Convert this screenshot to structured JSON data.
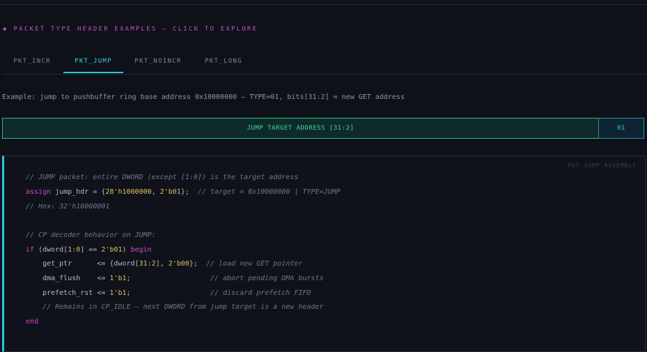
{
  "section_title": "PACKET TYPE HEADER EXAMPLES — CLICK TO EXPLORE",
  "tabs": [
    {
      "label": "PKT_INCR"
    },
    {
      "label": "PKT_JUMP"
    },
    {
      "label": "PKT_NOINCR"
    },
    {
      "label": "PKT_LONG"
    }
  ],
  "active_tab": "PKT_JUMP",
  "description": "Example: jump to pushbuffer ring base address 0x10000000 — TYPE=01, bits[31:2] = new GET address",
  "fields": [
    {
      "label": "JUMP TARGET ADDRESS [31:2]"
    },
    {
      "label": "01"
    }
  ],
  "code_caption": "PKT_JUMP ASSEMBLY",
  "code": {
    "l1": "// JUMP packet: entire DWORD (except [1:0]) is the target address",
    "l2_kw": "assign",
    "l2_a": " jump_hdr = {",
    "l2_n1": "28'h1000000",
    "l2_b": ", ",
    "l2_n2": "2'b01",
    "l2_c": "};  ",
    "l2_cm": "// target = 0x10000000 | TYPE=JUMP",
    "l3": "// Hex: 32'h10000001",
    "l5": "// CP decoder behavior on JUMP:",
    "l6_kw1": "if",
    "l6_a": " (dword[",
    "l6_n1": "1",
    "l6_b": ":",
    "l6_n2": "0",
    "l6_c": "] == ",
    "l6_n3": "2'b01",
    "l6_d": ") ",
    "l6_kw2": "begin",
    "l7_a": "    get_ptr      <= {dword[",
    "l7_n1": "31",
    "l7_b": ":",
    "l7_n2": "2",
    "l7_c": "], ",
    "l7_n3": "2'b00",
    "l7_d": "};  ",
    "l7_cm": "// load new GET pointer",
    "l8_a": "    dma_flush    <= ",
    "l8_n": "1'b1",
    "l8_b": ";                   ",
    "l8_cm": "// abort pending DMA bursts",
    "l9_a": "    prefetch_rst <= ",
    "l9_n": "1'b1",
    "l9_b": ";                   ",
    "l9_cm": "// discard prefetch FIFO",
    "l10": "    // Remains in CP_IDLE — next DWORD from jump target is a new header",
    "l11_kw": "end"
  }
}
